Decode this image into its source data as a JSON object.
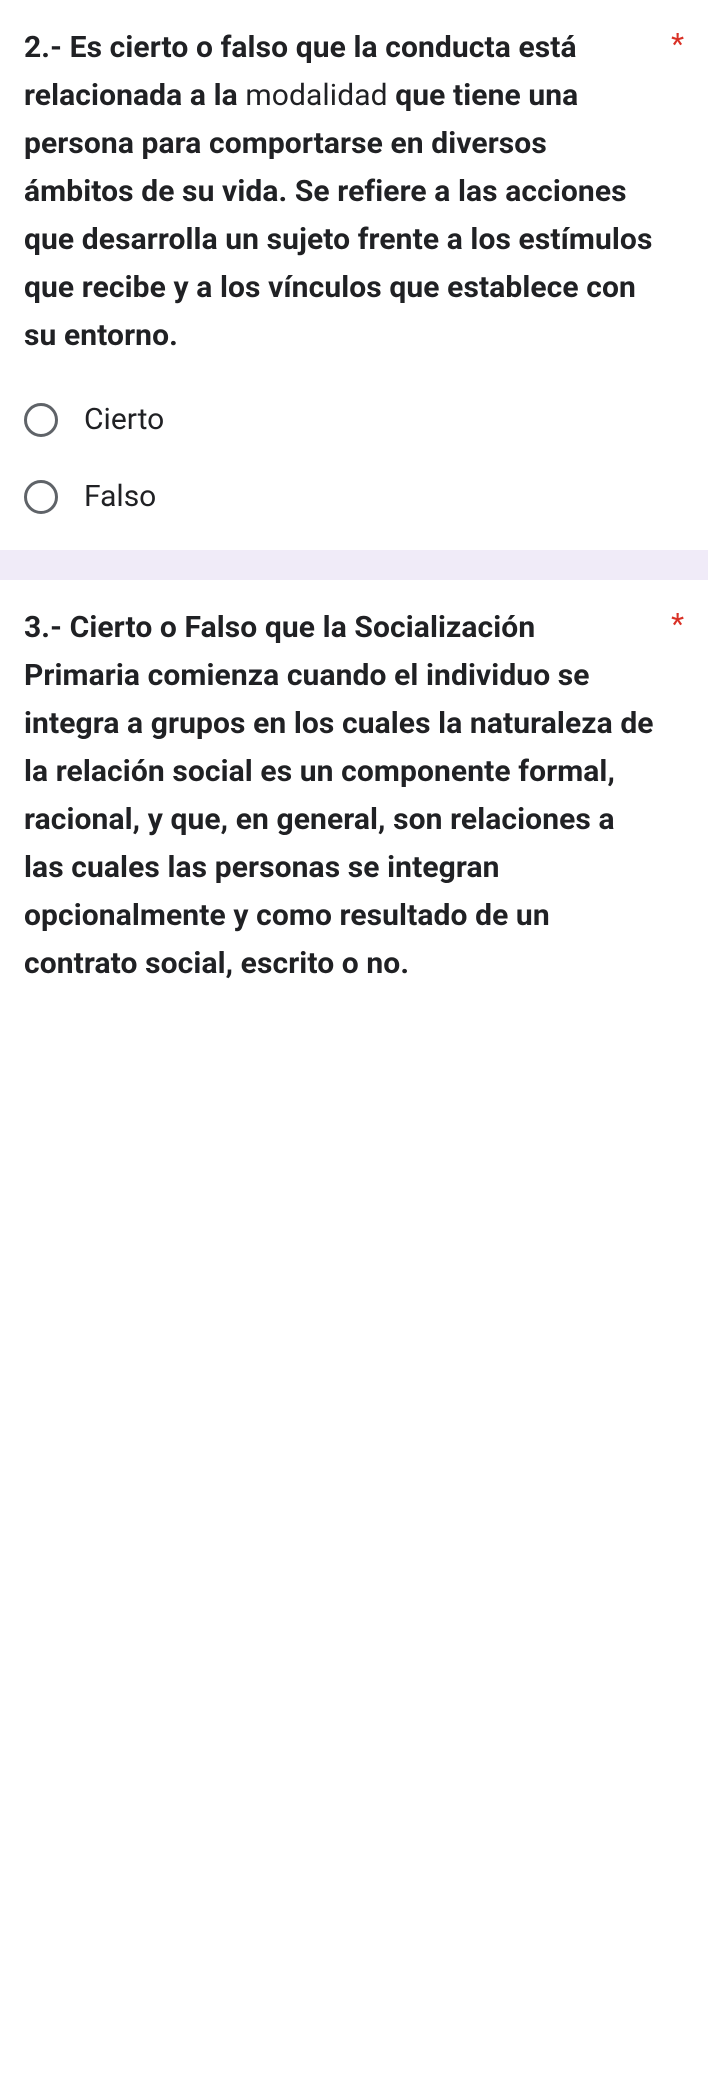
{
  "questions": [
    {
      "number": "2.- ",
      "text_parts": [
        {
          "bold": true,
          "text": "Es cierto o falso que la conducta está relacionada a la "
        },
        {
          "bold": false,
          "text": "modalidad"
        },
        {
          "bold": true,
          "text": " que tiene una persona para comportarse en diversos ámbitos de su vida. Se refiere a las acciones que desarrolla un sujeto frente a los estímulos que recibe y a los vínculos que establece con su entorno."
        }
      ],
      "required_marker": "*",
      "options": [
        {
          "label": "Cierto"
        },
        {
          "label": "Falso"
        }
      ]
    },
    {
      "number": "3.- ",
      "text_parts": [
        {
          "bold": true,
          "text": "Cierto o Falso que la Socialización Primaria comienza cuando el individuo se integra a grupos en los cuales la naturaleza de la relación social es un componente formal, racional, y que, en general, son relaciones a las cuales las personas se integran opcionalmente y como resultado de un contrato social, escrito o no."
        }
      ],
      "required_marker": "*",
      "options": []
    }
  ]
}
